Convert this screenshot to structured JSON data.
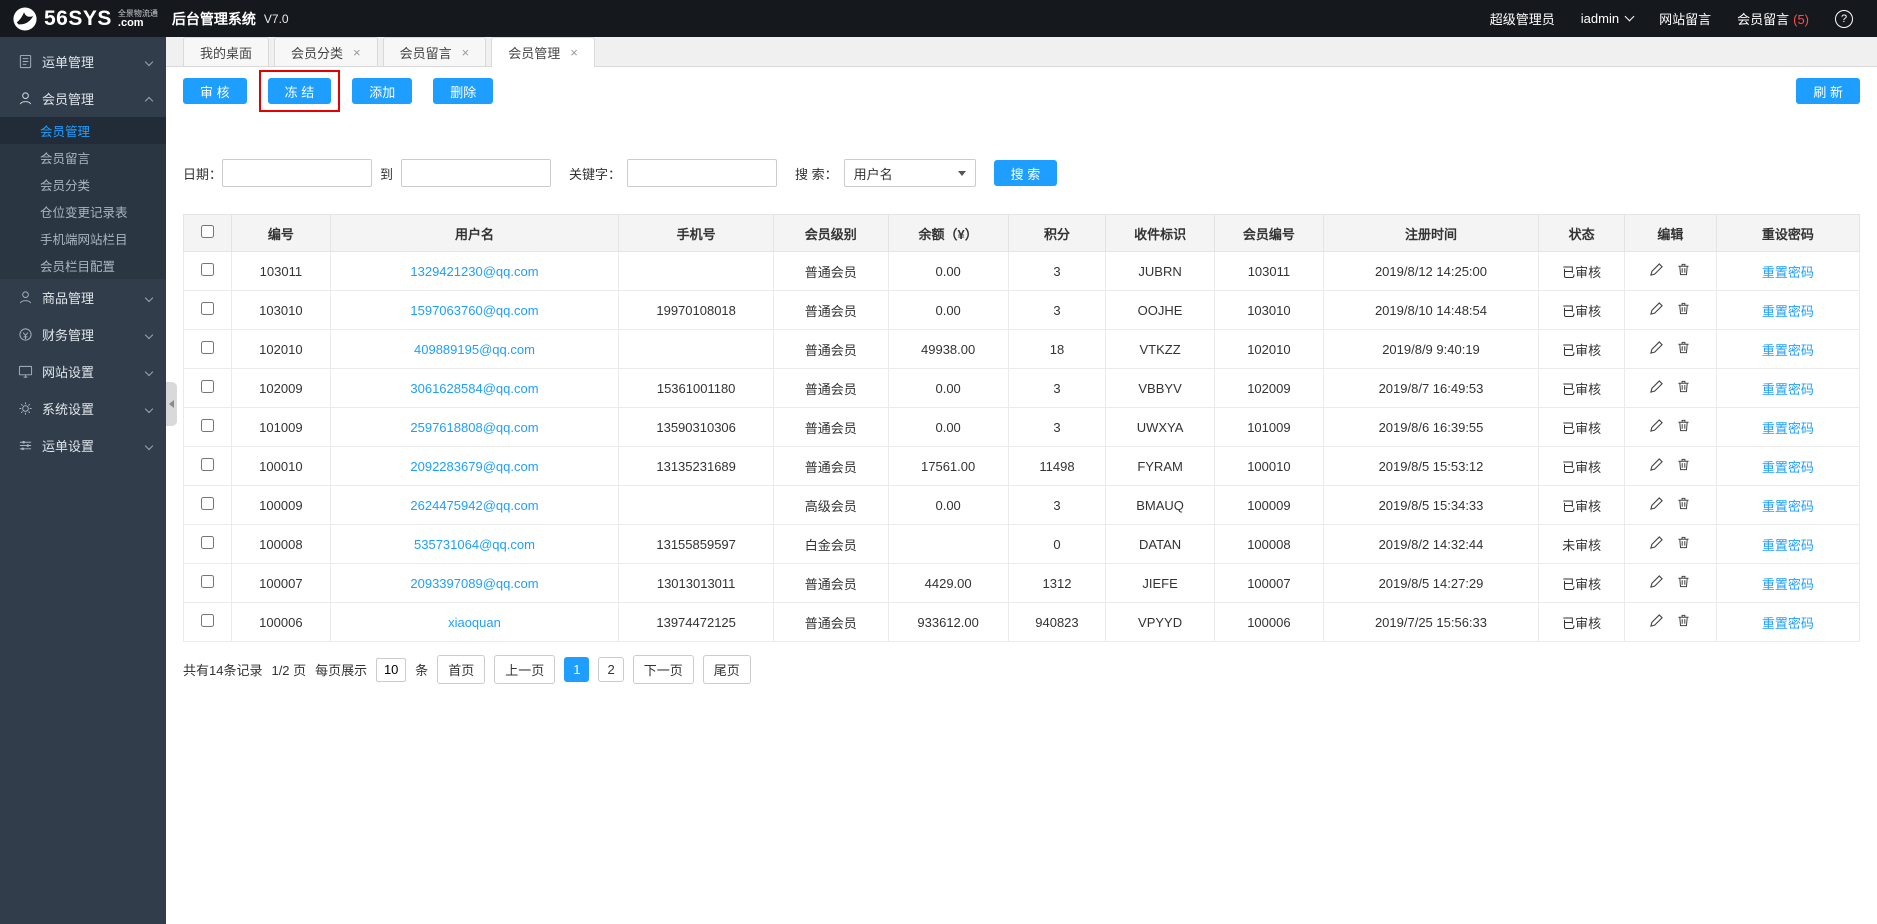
{
  "colors": {
    "accent": "#1E9FFF",
    "link": "#1E9FFF",
    "annotation": "#e60000",
    "message_count": "#ff4d4d",
    "topbar_bg": "#15181d",
    "sidebar_bg": "#313d4b"
  },
  "header": {
    "logo_main": "56SYS",
    "logo_dot": ".com",
    "logo_tagline": "全景物流通",
    "app_title": "后台管理系统",
    "version": "V7.0",
    "role": "超级管理员",
    "username": "iadmin",
    "site_msg_label": "网站留言",
    "member_msg_label": "会员留言",
    "member_msg_count": "(5)",
    "help_glyph": "?"
  },
  "sidebar": {
    "groups": [
      {
        "label": "运单管理"
      },
      {
        "label": "会员管理"
      },
      {
        "label": "商品管理"
      },
      {
        "label": "财务管理"
      },
      {
        "label": "网站设置"
      },
      {
        "label": "系统设置"
      },
      {
        "label": "运单设置"
      }
    ],
    "member_children": [
      {
        "label": "会员管理"
      },
      {
        "label": "会员留言"
      },
      {
        "label": "会员分类"
      },
      {
        "label": "仓位变更记录表"
      },
      {
        "label": "手机端网站栏目"
      },
      {
        "label": "会员栏目配置"
      }
    ]
  },
  "tabs": [
    {
      "label": "我的桌面",
      "close": ""
    },
    {
      "label": "会员分类",
      "close": "×"
    },
    {
      "label": "会员留言",
      "close": "×"
    },
    {
      "label": "会员管理",
      "close": "×"
    }
  ],
  "toolbar": {
    "audit": "审 核",
    "freeze": "冻 结",
    "add": "添加",
    "delete": "删除",
    "refresh": "刷 新"
  },
  "filters": {
    "date_label": "日期：",
    "to_label": "到",
    "keyword_label": "关键字：",
    "search_label": "搜 索：",
    "search_type": "用户名",
    "search_button": "搜 索"
  },
  "table": {
    "headers": [
      "编号",
      "用户名",
      "手机号",
      "会员级别",
      "余额（¥）",
      "积分",
      "收件标识",
      "会员编号",
      "注册时间",
      "状态",
      "编辑",
      "重设密码"
    ],
    "reset_label": "重置密码",
    "rows": [
      {
        "id": "103011",
        "username": "1329421230@qq.com",
        "phone": "",
        "level": "普通会员",
        "balance": "0.00",
        "points": "3",
        "code": "JUBRN",
        "member_no": "103011",
        "reg_time": "2019/8/12 14:25:00",
        "status": "已审核"
      },
      {
        "id": "103010",
        "username": "1597063760@qq.com",
        "phone": "19970108018",
        "level": "普通会员",
        "balance": "0.00",
        "points": "3",
        "code": "OOJHE",
        "member_no": "103010",
        "reg_time": "2019/8/10 14:48:54",
        "status": "已审核"
      },
      {
        "id": "102010",
        "username": "409889195@qq.com",
        "phone": "",
        "level": "普通会员",
        "balance": "49938.00",
        "points": "18",
        "code": "VTKZZ",
        "member_no": "102010",
        "reg_time": "2019/8/9 9:40:19",
        "status": "已审核"
      },
      {
        "id": "102009",
        "username": "3061628584@qq.com",
        "phone": "15361001180",
        "level": "普通会员",
        "balance": "0.00",
        "points": "3",
        "code": "VBBYV",
        "member_no": "102009",
        "reg_time": "2019/8/7 16:49:53",
        "status": "已审核"
      },
      {
        "id": "101009",
        "username": "2597618808@qq.com",
        "phone": "13590310306",
        "level": "普通会员",
        "balance": "0.00",
        "points": "3",
        "code": "UWXYA",
        "member_no": "101009",
        "reg_time": "2019/8/6 16:39:55",
        "status": "已审核"
      },
      {
        "id": "100010",
        "username": "2092283679@qq.com",
        "phone": "13135231689",
        "level": "普通会员",
        "balance": "17561.00",
        "points": "11498",
        "code": "FYRAM",
        "member_no": "100010",
        "reg_time": "2019/8/5 15:53:12",
        "status": "已审核"
      },
      {
        "id": "100009",
        "username": "2624475942@qq.com",
        "phone": "",
        "level": "高级会员",
        "balance": "0.00",
        "points": "3",
        "code": "BMAUQ",
        "member_no": "100009",
        "reg_time": "2019/8/5 15:34:33",
        "status": "已审核"
      },
      {
        "id": "100008",
        "username": "535731064@qq.com",
        "phone": "13155859597",
        "level": "白金会员",
        "balance": "",
        "points": "0",
        "code": "DATAN",
        "member_no": "100008",
        "reg_time": "2019/8/2 14:32:44",
        "status": "未审核"
      },
      {
        "id": "100007",
        "username": "2093397089@qq.com",
        "phone": "13013013011",
        "level": "普通会员",
        "balance": "4429.00",
        "points": "1312",
        "code": "JIEFE",
        "member_no": "100007",
        "reg_time": "2019/8/5 14:27:29",
        "status": "已审核"
      },
      {
        "id": "100006",
        "username": "xiaoquan",
        "phone": "13974472125",
        "level": "普通会员",
        "balance": "933612.00",
        "points": "940823",
        "code": "VPYYD",
        "member_no": "100006",
        "reg_time": "2019/7/25 15:56:33",
        "status": "已审核"
      }
    ]
  },
  "pagination": {
    "total": "共有14条记录",
    "page_info": "1/2 页",
    "per_page_label": "每页展示",
    "per_page_value": "10",
    "per_page_unit": "条",
    "first": "首页",
    "prev": "上一页",
    "page1": "1",
    "page2": "2",
    "next": "下一页",
    "last": "尾页"
  }
}
